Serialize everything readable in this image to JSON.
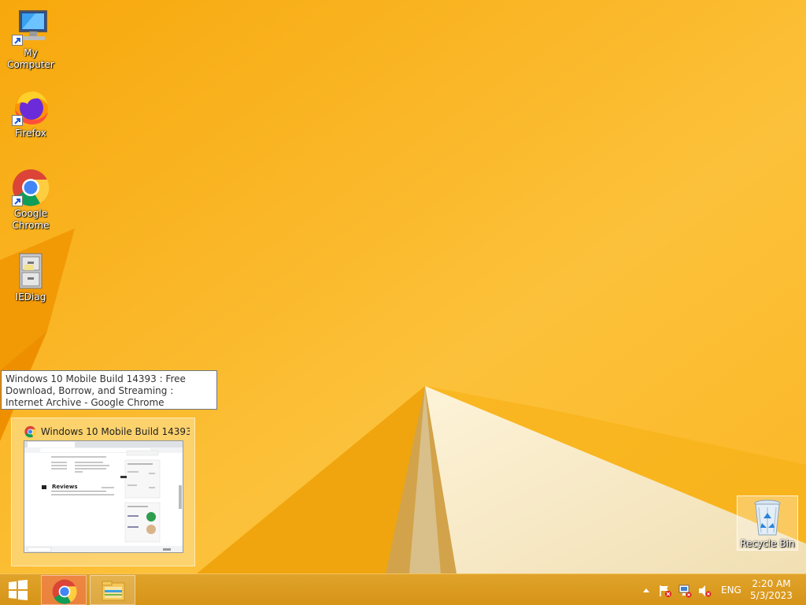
{
  "desktop": {
    "icons": [
      {
        "label": "My Computer",
        "icon": "computer-icon"
      },
      {
        "label": "Firefox",
        "icon": "firefox-icon"
      },
      {
        "label": "Google Chrome",
        "icon": "chrome-icon"
      },
      {
        "label": "IEDiag",
        "icon": "file-cabinet-icon"
      }
    ],
    "recycle_bin": {
      "label": "Recycle Bin",
      "icon": "recycle-bin-icon"
    }
  },
  "tooltip": {
    "text": "Windows 10 Mobile Build 14393 : Free Download, Borrow, and Streaming : Internet Archive - Google Chrome"
  },
  "thumbnail": {
    "title": "Windows 10 Mobile Build 14393...",
    "page_heading": "Reviews"
  },
  "taskbar": {
    "start_icon": "windows-logo-icon",
    "pinned": [
      {
        "name": "Google Chrome",
        "icon": "chrome-icon",
        "active": true
      },
      {
        "name": "File Explorer",
        "icon": "folder-icon",
        "active": false
      }
    ],
    "tray": {
      "language": "ENG",
      "time": "2:20 AM",
      "date": "5/3/2023"
    }
  },
  "colors": {
    "wallpaper": "#f9b414",
    "taskbar": "#d69418"
  }
}
